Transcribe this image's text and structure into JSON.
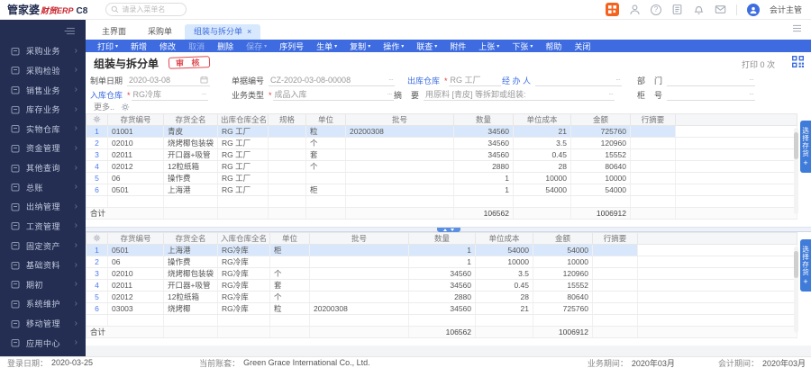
{
  "ui": {
    "required_mark": "*",
    "ellipsis": "···",
    "caret": "▾",
    "close_mark": "×",
    "chevron": "›"
  },
  "brand": {
    "main": "管家婆",
    "sub": "财贸ERP",
    "version": "C8"
  },
  "topbar": {
    "search_placeholder": "请录入菜单名",
    "user": "会计主管",
    "help_glyph": "?"
  },
  "sidebar": {
    "items": [
      {
        "name": "purchase",
        "label": "采购业务"
      },
      {
        "name": "purchase-inspection",
        "label": "采购检验"
      },
      {
        "name": "sales",
        "label": "销售业务"
      },
      {
        "name": "inventory",
        "label": "库存业务"
      },
      {
        "name": "physical-warehouse",
        "label": "实物仓库"
      },
      {
        "name": "funds",
        "label": "资金管理"
      },
      {
        "name": "other-query",
        "label": "其他查询"
      },
      {
        "name": "general-ledger",
        "label": "总账"
      },
      {
        "name": "cashier",
        "label": "出纳管理"
      },
      {
        "name": "payroll",
        "label": "工资管理"
      },
      {
        "name": "fixed-assets",
        "label": "固定资产"
      },
      {
        "name": "base-data",
        "label": "基础资料"
      },
      {
        "name": "opening",
        "label": "期初"
      },
      {
        "name": "system-maintenance",
        "label": "系统维护"
      },
      {
        "name": "mobile",
        "label": "移动管理"
      },
      {
        "name": "app-center",
        "label": "应用中心"
      }
    ]
  },
  "tabs": [
    {
      "name": "main",
      "label": "主界面"
    },
    {
      "name": "purchase-order",
      "label": "采购单"
    },
    {
      "name": "assembly-split",
      "label": "组装与拆分单",
      "active": true,
      "closable": true
    }
  ],
  "toolbar": [
    {
      "name": "print",
      "label": "打印",
      "caret": true
    },
    {
      "name": "new",
      "label": "新增"
    },
    {
      "name": "edit",
      "label": "修改"
    },
    {
      "name": "cancel",
      "label": "取消",
      "disabled": true
    },
    {
      "name": "delete",
      "label": "删除"
    },
    {
      "name": "save",
      "label": "保存",
      "caret": true,
      "disabled": true
    },
    {
      "name": "serial-no",
      "label": "序列号"
    },
    {
      "name": "generate",
      "label": "生单",
      "caret": true
    },
    {
      "name": "copy",
      "label": "复制",
      "caret": true
    },
    {
      "name": "action",
      "label": "操作",
      "caret": true
    },
    {
      "name": "linked-query",
      "label": "联查",
      "caret": true
    },
    {
      "name": "attachment",
      "label": "附件"
    },
    {
      "name": "prev",
      "label": "上张",
      "caret": true
    },
    {
      "name": "next",
      "label": "下张",
      "caret": true
    },
    {
      "name": "help",
      "label": "帮助"
    },
    {
      "name": "close",
      "label": "关闭"
    }
  ],
  "doc": {
    "title": "组装与拆分单",
    "stamp": "审 核",
    "print_count_text": "打印 0 次",
    "more_label": "更多..",
    "fields": {
      "make_date": {
        "label": "制单日期",
        "value": "2020-03-08"
      },
      "doc_no": {
        "label": "单据编号",
        "value": "CZ-2020-03-08-00008"
      },
      "out_wh": {
        "label": "出库仓库",
        "value": "RG 工厂"
      },
      "operator": {
        "label": "经 办 人",
        "value": ""
      },
      "department": {
        "label": "部    门",
        "value": ""
      },
      "in_wh": {
        "label": "入库仓库",
        "value": "RG冷库"
      },
      "biz_type": {
        "label": "业务类型",
        "value": "成品入库"
      },
      "summary": {
        "label": "摘    要",
        "value": "用原料 [青皮] 等拆卸或组装:"
      },
      "cabinet_no": {
        "label": "柜    号",
        "value": ""
      }
    }
  },
  "out_table": {
    "name": "outbound-detail",
    "columns": [
      {
        "key": "code",
        "label": "存货编号"
      },
      {
        "key": "iname",
        "label": "存货全名"
      },
      {
        "key": "wh",
        "label": "出库仓库全名"
      },
      {
        "key": "spec",
        "label": "规格"
      },
      {
        "key": "unit",
        "label": "单位"
      },
      {
        "key": "batch",
        "label": "批号"
      },
      {
        "key": "qty",
        "label": "数量"
      },
      {
        "key": "cost",
        "label": "单位成本"
      },
      {
        "key": "amount",
        "label": "金额"
      },
      {
        "key": "memo",
        "label": "行摘要"
      }
    ],
    "rows": [
      {
        "code": "01001",
        "iname": "青皮",
        "wh": "RG 工厂",
        "spec": "",
        "unit": "粒",
        "batch": "20200308",
        "qty": "34560",
        "cost": "21",
        "amount": "725760",
        "memo": ""
      },
      {
        "code": "02010",
        "iname": "烧烤椰包装袋",
        "wh": "RG 工厂",
        "spec": "",
        "unit": "个",
        "batch": "",
        "qty": "34560",
        "cost": "3.5",
        "amount": "120960",
        "memo": ""
      },
      {
        "code": "02011",
        "iname": "开口器+吸管",
        "wh": "RG 工厂",
        "spec": "",
        "unit": "套",
        "batch": "",
        "qty": "34560",
        "cost": "0.45",
        "amount": "15552",
        "memo": ""
      },
      {
        "code": "02012",
        "iname": "12粒纸箱",
        "wh": "RG 工厂",
        "spec": "",
        "unit": "个",
        "batch": "",
        "qty": "2880",
        "cost": "28",
        "amount": "80640",
        "memo": ""
      },
      {
        "code": "06",
        "iname": "操作费",
        "wh": "RG 工厂",
        "spec": "",
        "unit": "",
        "batch": "",
        "qty": "1",
        "cost": "10000",
        "amount": "10000",
        "memo": ""
      },
      {
        "code": "0501",
        "iname": "上海港",
        "wh": "RG 工厂",
        "spec": "",
        "unit": "柜",
        "batch": "",
        "qty": "1",
        "cost": "54000",
        "amount": "54000",
        "memo": ""
      }
    ],
    "highlight_row": 0,
    "total_label": "合计",
    "totals": {
      "qty": "106562",
      "amount": "1006912"
    }
  },
  "in_table": {
    "name": "inbound-detail",
    "columns": [
      {
        "key": "code",
        "label": "存货编号"
      },
      {
        "key": "iname",
        "label": "存货全名"
      },
      {
        "key": "wh",
        "label": "入库仓库全名"
      },
      {
        "key": "unit",
        "label": "单位"
      },
      {
        "key": "batch",
        "label": "批号"
      },
      {
        "key": "qty",
        "label": "数量"
      },
      {
        "key": "cost",
        "label": "单位成本"
      },
      {
        "key": "amount",
        "label": "金额"
      },
      {
        "key": "memo",
        "label": "行摘要"
      }
    ],
    "rows": [
      {
        "code": "0501",
        "iname": "上海港",
        "wh": "RG冷库",
        "unit": "柜",
        "batch": "",
        "qty": "1",
        "cost": "54000",
        "amount": "54000",
        "memo": ""
      },
      {
        "code": "06",
        "iname": "操作费",
        "wh": "RG冷库",
        "unit": "",
        "batch": "",
        "qty": "1",
        "cost": "10000",
        "amount": "10000",
        "memo": ""
      },
      {
        "code": "02010",
        "iname": "烧烤椰包装袋",
        "wh": "RG冷库",
        "unit": "个",
        "batch": "",
        "qty": "34560",
        "cost": "3.5",
        "amount": "120960",
        "memo": ""
      },
      {
        "code": "02011",
        "iname": "开口器+吸管",
        "wh": "RG冷库",
        "unit": "套",
        "batch": "",
        "qty": "34560",
        "cost": "0.45",
        "amount": "15552",
        "memo": ""
      },
      {
        "code": "02012",
        "iname": "12粒纸箱",
        "wh": "RG冷库",
        "unit": "个",
        "batch": "",
        "qty": "2880",
        "cost": "28",
        "amount": "80640",
        "memo": ""
      },
      {
        "code": "03003",
        "iname": "烧烤椰",
        "wh": "RG冷库",
        "unit": "粒",
        "batch": "20200308",
        "qty": "34560",
        "cost": "21",
        "amount": "725760",
        "memo": ""
      }
    ],
    "highlight_row": 0,
    "total_label": "合计",
    "totals": {
      "qty": "106562",
      "amount": "1006912"
    }
  },
  "side_tab": {
    "label": "选择存货",
    "plus": "+"
  },
  "statusbar": {
    "login_label": "登录日期：",
    "login_value": "2020-03-25",
    "acct_label": "当前账套：",
    "acct_value": "Green Grace International Co., Ltd.",
    "biz_label": "业务期间：",
    "biz_value": "2020年03月",
    "fiscal_label": "会计期间：",
    "fiscal_value": "2020年03月"
  }
}
